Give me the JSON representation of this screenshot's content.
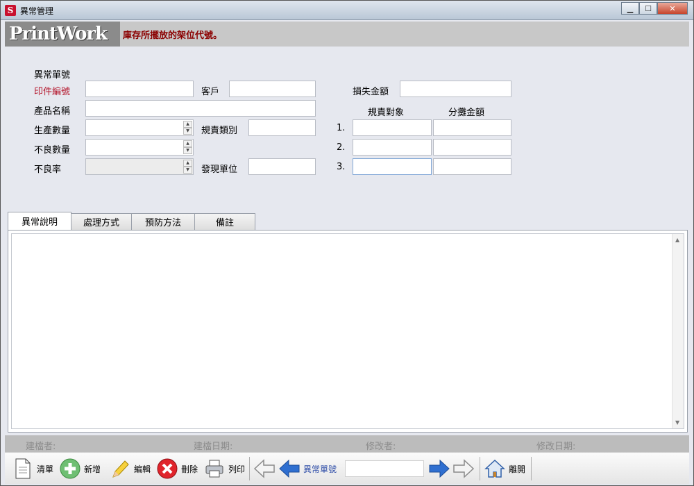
{
  "window": {
    "title": "異常管理",
    "icon_label": "S"
  },
  "header": {
    "logo_text": "PrintWork",
    "message": "庫存所擺放的架位代號。"
  },
  "form": {
    "anomaly_no_label": "異常單號",
    "print_no_label": "印件編號",
    "customer_label": "客戶",
    "product_name_label": "產品名稱",
    "production_qty_label": "生產數量",
    "defect_qty_label": "不良數量",
    "defect_rate_label": "不良率",
    "responsibility_type_label": "規責類別",
    "found_unit_label": "發現單位",
    "loss_amount_label": "損失金額",
    "responsible_target_header": "規責對象",
    "allocated_amount_header": "分攤金額",
    "rows": [
      "1.",
      "2.",
      "3."
    ],
    "values": {
      "print_no": "",
      "customer": "",
      "product_name": "",
      "production_qty": "",
      "defect_qty": "",
      "defect_rate": "",
      "responsibility_type": "",
      "found_unit": "",
      "loss_amount": ""
    }
  },
  "tabs": [
    {
      "label": "異常說明",
      "active": true
    },
    {
      "label": "處理方式",
      "active": false
    },
    {
      "label": "預防方法",
      "active": false
    },
    {
      "label": "備註",
      "active": false
    }
  ],
  "status": {
    "creator": "建檔者:",
    "created_date": "建檔日期:",
    "modifier": "修改者:",
    "modified_date": "修改日期:"
  },
  "toolbar": {
    "clear": "清單",
    "add": "新增",
    "edit": "編輯",
    "delete": "刪除",
    "print": "列印",
    "nav_label": "異常單號",
    "nav_value": "",
    "exit": "離開"
  },
  "icons": [
    "document-icon",
    "add-icon",
    "pencil-icon",
    "delete-icon",
    "printer-icon",
    "arrow-left-outline-icon",
    "arrow-left-icon",
    "arrow-right-icon",
    "arrow-right-outline-icon",
    "home-icon"
  ],
  "colors": {
    "header_message": "#8b0000",
    "required_label": "#b4142a",
    "nav_arrow": "#2f6fd0"
  }
}
